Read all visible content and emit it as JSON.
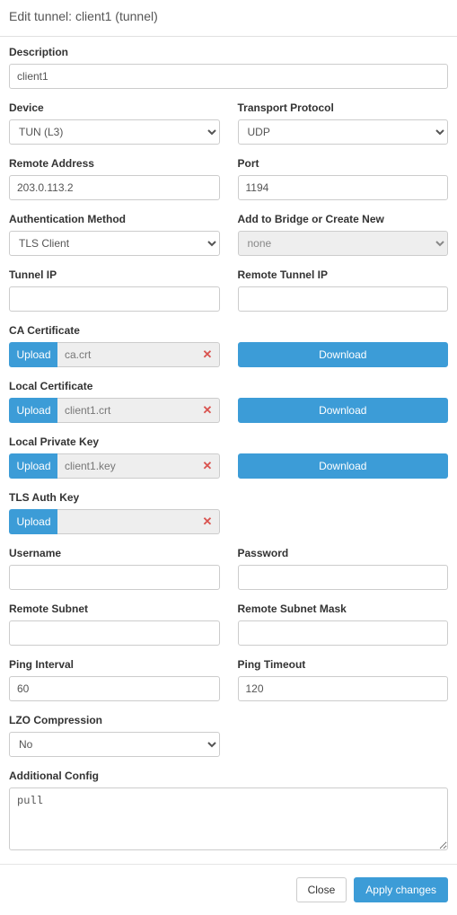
{
  "header": {
    "title": "Edit tunnel: client1 (tunnel)"
  },
  "labels": {
    "description": "Description",
    "device": "Device",
    "transport": "Transport Protocol",
    "remote_addr": "Remote Address",
    "port": "Port",
    "auth_method": "Authentication Method",
    "bridge": "Add to Bridge or Create New",
    "tunnel_ip": "Tunnel IP",
    "remote_tunnel_ip": "Remote Tunnel IP",
    "ca_cert": "CA Certificate",
    "local_cert": "Local Certificate",
    "local_key": "Local Private Key",
    "tls_auth": "TLS Auth Key",
    "username": "Username",
    "password": "Password",
    "remote_subnet": "Remote Subnet",
    "remote_mask": "Remote Subnet Mask",
    "ping_interval": "Ping Interval",
    "ping_timeout": "Ping Timeout",
    "lzo": "LZO Compression",
    "add_config": "Additional Config"
  },
  "values": {
    "description": "client1",
    "device": "TUN (L3)",
    "transport": "UDP",
    "remote_addr": "203.0.113.2",
    "port": "1194",
    "auth_method": "TLS Client",
    "bridge": "none",
    "tunnel_ip": "",
    "remote_tunnel_ip": "",
    "username": "",
    "password": "",
    "remote_subnet": "",
    "remote_mask": "",
    "ping_interval": "60",
    "ping_timeout": "120",
    "lzo": "No",
    "add_config": "pull"
  },
  "files": {
    "ca_cert": "ca.crt",
    "local_cert": "client1.crt",
    "local_key": "client1.key",
    "tls_auth": ""
  },
  "buttons": {
    "upload": "Upload",
    "download": "Download",
    "close": "Close",
    "apply": "Apply changes"
  },
  "icons": {
    "delete": "✕"
  },
  "colors": {
    "primary": "#3c9cd7",
    "danger": "#d9534f"
  }
}
